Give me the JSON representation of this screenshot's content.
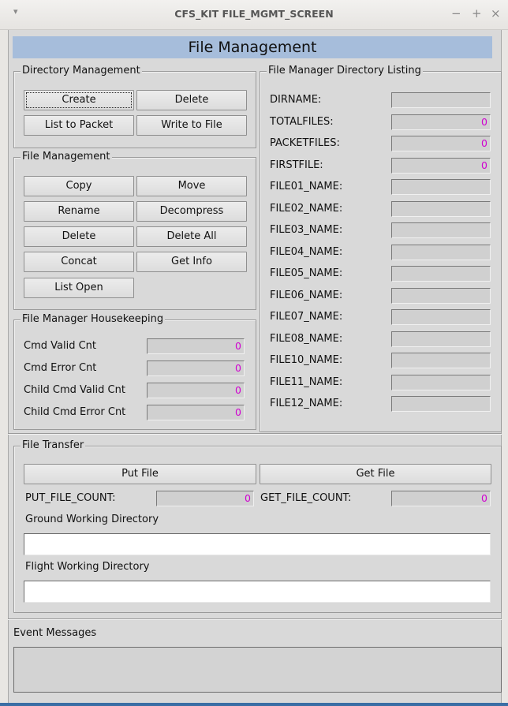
{
  "window": {
    "title": "CFS_KIT FILE_MGMT_SCREEN",
    "menu_glyph": "▾",
    "minimize_glyph": "−",
    "maximize_glyph": "+",
    "close_glyph": "×"
  },
  "screen_title": "File Management",
  "directory_management": {
    "label": "Directory Management",
    "buttons": [
      "Create",
      "Delete",
      "List to Packet",
      "Write to File"
    ]
  },
  "file_management": {
    "label": "File Management",
    "buttons": [
      "Copy",
      "Move",
      "Rename",
      "Decompress",
      "Delete",
      "Delete All",
      "Concat",
      "Get Info",
      "List Open"
    ]
  },
  "housekeeping": {
    "label": "File Manager Housekeeping",
    "rows": [
      {
        "label": "Cmd Valid Cnt",
        "value": "0"
      },
      {
        "label": "Cmd Error Cnt",
        "value": "0"
      },
      {
        "label": "Child Cmd Valid Cnt",
        "value": "0"
      },
      {
        "label": "Child Cmd Error Cnt",
        "value": "0"
      }
    ]
  },
  "directory_listing": {
    "label": "File Manager Directory Listing",
    "rows": [
      {
        "label": "DIRNAME:",
        "value": ""
      },
      {
        "label": "TOTALFILES:",
        "value": "0"
      },
      {
        "label": "PACKETFILES:",
        "value": "0"
      },
      {
        "label": "FIRSTFILE:",
        "value": "0"
      },
      {
        "label": "FILE01_NAME:",
        "value": ""
      },
      {
        "label": "FILE02_NAME:",
        "value": ""
      },
      {
        "label": "FILE03_NAME:",
        "value": ""
      },
      {
        "label": "FILE04_NAME:",
        "value": ""
      },
      {
        "label": "FILE05_NAME:",
        "value": ""
      },
      {
        "label": "FILE06_NAME:",
        "value": ""
      },
      {
        "label": "FILE07_NAME:",
        "value": ""
      },
      {
        "label": "FILE08_NAME:",
        "value": ""
      },
      {
        "label": "FILE10_NAME:",
        "value": ""
      },
      {
        "label": "FILE11_NAME:",
        "value": ""
      },
      {
        "label": "FILE12_NAME:",
        "value": ""
      }
    ]
  },
  "file_transfer": {
    "label": "File Transfer",
    "put_button": "Put File",
    "get_button": "Get File",
    "put_count_label": "PUT_FILE_COUNT:",
    "put_count_value": "0",
    "get_count_label": "GET_FILE_COUNT:",
    "get_count_value": "0",
    "ground_dir_label": "Ground Working Directory",
    "ground_dir_value": "",
    "flight_dir_label": "Flight Working Directory",
    "flight_dir_value": ""
  },
  "event_messages": {
    "label": "Event Messages",
    "text": ""
  },
  "colors": {
    "title_bar_bg": "#a6bddb",
    "value_text": "#d000d0",
    "panel_bg": "#d9d9d9"
  }
}
